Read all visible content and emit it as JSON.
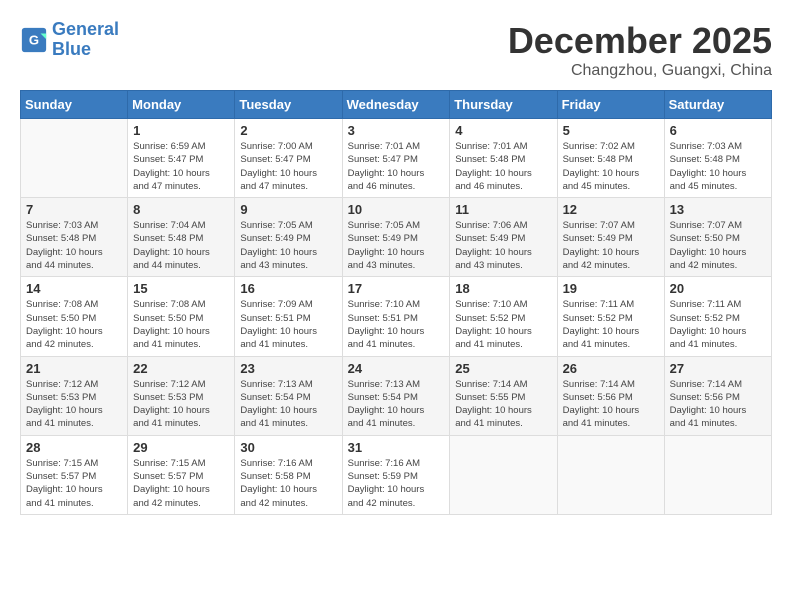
{
  "logo": {
    "line1": "General",
    "line2": "Blue"
  },
  "title": "December 2025",
  "location": "Changzhou, Guangxi, China",
  "days_of_week": [
    "Sunday",
    "Monday",
    "Tuesday",
    "Wednesday",
    "Thursday",
    "Friday",
    "Saturday"
  ],
  "weeks": [
    [
      {
        "day": "",
        "info": ""
      },
      {
        "day": "1",
        "info": "Sunrise: 6:59 AM\nSunset: 5:47 PM\nDaylight: 10 hours\nand 47 minutes."
      },
      {
        "day": "2",
        "info": "Sunrise: 7:00 AM\nSunset: 5:47 PM\nDaylight: 10 hours\nand 47 minutes."
      },
      {
        "day": "3",
        "info": "Sunrise: 7:01 AM\nSunset: 5:47 PM\nDaylight: 10 hours\nand 46 minutes."
      },
      {
        "day": "4",
        "info": "Sunrise: 7:01 AM\nSunset: 5:48 PM\nDaylight: 10 hours\nand 46 minutes."
      },
      {
        "day": "5",
        "info": "Sunrise: 7:02 AM\nSunset: 5:48 PM\nDaylight: 10 hours\nand 45 minutes."
      },
      {
        "day": "6",
        "info": "Sunrise: 7:03 AM\nSunset: 5:48 PM\nDaylight: 10 hours\nand 45 minutes."
      }
    ],
    [
      {
        "day": "7",
        "info": "Sunrise: 7:03 AM\nSunset: 5:48 PM\nDaylight: 10 hours\nand 44 minutes."
      },
      {
        "day": "8",
        "info": "Sunrise: 7:04 AM\nSunset: 5:48 PM\nDaylight: 10 hours\nand 44 minutes."
      },
      {
        "day": "9",
        "info": "Sunrise: 7:05 AM\nSunset: 5:49 PM\nDaylight: 10 hours\nand 43 minutes."
      },
      {
        "day": "10",
        "info": "Sunrise: 7:05 AM\nSunset: 5:49 PM\nDaylight: 10 hours\nand 43 minutes."
      },
      {
        "day": "11",
        "info": "Sunrise: 7:06 AM\nSunset: 5:49 PM\nDaylight: 10 hours\nand 43 minutes."
      },
      {
        "day": "12",
        "info": "Sunrise: 7:07 AM\nSunset: 5:49 PM\nDaylight: 10 hours\nand 42 minutes."
      },
      {
        "day": "13",
        "info": "Sunrise: 7:07 AM\nSunset: 5:50 PM\nDaylight: 10 hours\nand 42 minutes."
      }
    ],
    [
      {
        "day": "14",
        "info": "Sunrise: 7:08 AM\nSunset: 5:50 PM\nDaylight: 10 hours\nand 42 minutes."
      },
      {
        "day": "15",
        "info": "Sunrise: 7:08 AM\nSunset: 5:50 PM\nDaylight: 10 hours\nand 41 minutes."
      },
      {
        "day": "16",
        "info": "Sunrise: 7:09 AM\nSunset: 5:51 PM\nDaylight: 10 hours\nand 41 minutes."
      },
      {
        "day": "17",
        "info": "Sunrise: 7:10 AM\nSunset: 5:51 PM\nDaylight: 10 hours\nand 41 minutes."
      },
      {
        "day": "18",
        "info": "Sunrise: 7:10 AM\nSunset: 5:52 PM\nDaylight: 10 hours\nand 41 minutes."
      },
      {
        "day": "19",
        "info": "Sunrise: 7:11 AM\nSunset: 5:52 PM\nDaylight: 10 hours\nand 41 minutes."
      },
      {
        "day": "20",
        "info": "Sunrise: 7:11 AM\nSunset: 5:52 PM\nDaylight: 10 hours\nand 41 minutes."
      }
    ],
    [
      {
        "day": "21",
        "info": "Sunrise: 7:12 AM\nSunset: 5:53 PM\nDaylight: 10 hours\nand 41 minutes."
      },
      {
        "day": "22",
        "info": "Sunrise: 7:12 AM\nSunset: 5:53 PM\nDaylight: 10 hours\nand 41 minutes."
      },
      {
        "day": "23",
        "info": "Sunrise: 7:13 AM\nSunset: 5:54 PM\nDaylight: 10 hours\nand 41 minutes."
      },
      {
        "day": "24",
        "info": "Sunrise: 7:13 AM\nSunset: 5:54 PM\nDaylight: 10 hours\nand 41 minutes."
      },
      {
        "day": "25",
        "info": "Sunrise: 7:14 AM\nSunset: 5:55 PM\nDaylight: 10 hours\nand 41 minutes."
      },
      {
        "day": "26",
        "info": "Sunrise: 7:14 AM\nSunset: 5:56 PM\nDaylight: 10 hours\nand 41 minutes."
      },
      {
        "day": "27",
        "info": "Sunrise: 7:14 AM\nSunset: 5:56 PM\nDaylight: 10 hours\nand 41 minutes."
      }
    ],
    [
      {
        "day": "28",
        "info": "Sunrise: 7:15 AM\nSunset: 5:57 PM\nDaylight: 10 hours\nand 41 minutes."
      },
      {
        "day": "29",
        "info": "Sunrise: 7:15 AM\nSunset: 5:57 PM\nDaylight: 10 hours\nand 42 minutes."
      },
      {
        "day": "30",
        "info": "Sunrise: 7:16 AM\nSunset: 5:58 PM\nDaylight: 10 hours\nand 42 minutes."
      },
      {
        "day": "31",
        "info": "Sunrise: 7:16 AM\nSunset: 5:59 PM\nDaylight: 10 hours\nand 42 minutes."
      },
      {
        "day": "",
        "info": ""
      },
      {
        "day": "",
        "info": ""
      },
      {
        "day": "",
        "info": ""
      }
    ]
  ]
}
